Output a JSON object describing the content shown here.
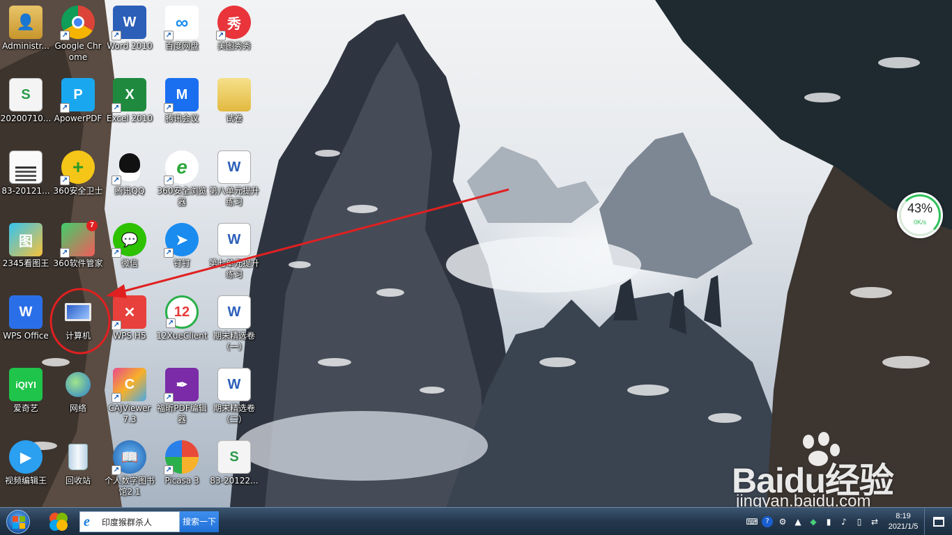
{
  "desktop": {
    "icons": [
      {
        "label": "Administr...",
        "icon": "user-folder-icon"
      },
      {
        "label": "Google Chrome",
        "icon": "chrome-icon"
      },
      {
        "label": "Word 2010",
        "icon": "word-icon"
      },
      {
        "label": "百度网盘",
        "icon": "baidu-netdisk-icon"
      },
      {
        "label": "美图秀秀",
        "icon": "meitu-icon"
      },
      {
        "label": "20200710...",
        "icon": "spreadsheet-file-icon"
      },
      {
        "label": "ApowerPDF",
        "icon": "apowerpdf-icon"
      },
      {
        "label": "Excel 2010",
        "icon": "excel-icon"
      },
      {
        "label": "腾讯会议",
        "icon": "tencent-meeting-icon"
      },
      {
        "label": "试卷",
        "icon": "folder-icon"
      },
      {
        "label": "83-20121...",
        "icon": "document-thumbnail-icon"
      },
      {
        "label": "360安全卫士",
        "icon": "360-security-icon"
      },
      {
        "label": "腾讯QQ",
        "icon": "qq-icon"
      },
      {
        "label": "360安全浏览器",
        "icon": "360-browser-icon"
      },
      {
        "label": "第八单元提升练习",
        "icon": "word-document-icon"
      },
      {
        "label": "2345看图王",
        "icon": "2345-viewer-icon"
      },
      {
        "label": "360软件管家",
        "icon": "360-software-manager-icon"
      },
      {
        "label": "微信",
        "icon": "wechat-icon"
      },
      {
        "label": "钉钉",
        "icon": "dingtalk-icon"
      },
      {
        "label": "第七单元提升练习",
        "icon": "word-document-icon"
      },
      {
        "label": "WPS Office",
        "icon": "wps-office-icon"
      },
      {
        "label": "计算机",
        "icon": "computer-icon"
      },
      {
        "label": "WPS H5",
        "icon": "wps-h5-icon"
      },
      {
        "label": "12XueClient",
        "icon": "12xue-client-icon"
      },
      {
        "label": "期末精选卷（一）",
        "icon": "word-document-icon"
      },
      {
        "label": "爱奇艺",
        "icon": "iqiyi-icon"
      },
      {
        "label": "网络",
        "icon": "network-icon"
      },
      {
        "label": "CAJViewer 7.3",
        "icon": "cajviewer-icon"
      },
      {
        "label": "福昕PDF编辑器",
        "icon": "foxit-pdf-editor-icon"
      },
      {
        "label": "期末精选卷（二）",
        "icon": "word-document-icon"
      },
      {
        "label": "视频编辑王",
        "icon": "video-editor-icon"
      },
      {
        "label": "回收站",
        "icon": "recycle-bin-icon"
      },
      {
        "label": "个人数字图书馆2.1",
        "icon": "digital-library-icon"
      },
      {
        "label": "Picasa 3",
        "icon": "picasa-icon"
      },
      {
        "label": "83-20122...",
        "icon": "spreadsheet-file-icon"
      }
    ],
    "badge_360_software": "7"
  },
  "network_widget": {
    "percent": "43%",
    "speed": "0K/s"
  },
  "watermark": {
    "brand": "Baidu经验",
    "url": "jingyan.baidu.com"
  },
  "taskbar": {
    "search_value": "印度猴群杀人",
    "search_button": "搜索一下",
    "clock_time": "8:19",
    "clock_date": "2021/1/5"
  },
  "colors": {
    "annotation_red": "#e02020",
    "taskbar_bg": "#24384e",
    "search_button_blue": "#1f6fd6"
  }
}
